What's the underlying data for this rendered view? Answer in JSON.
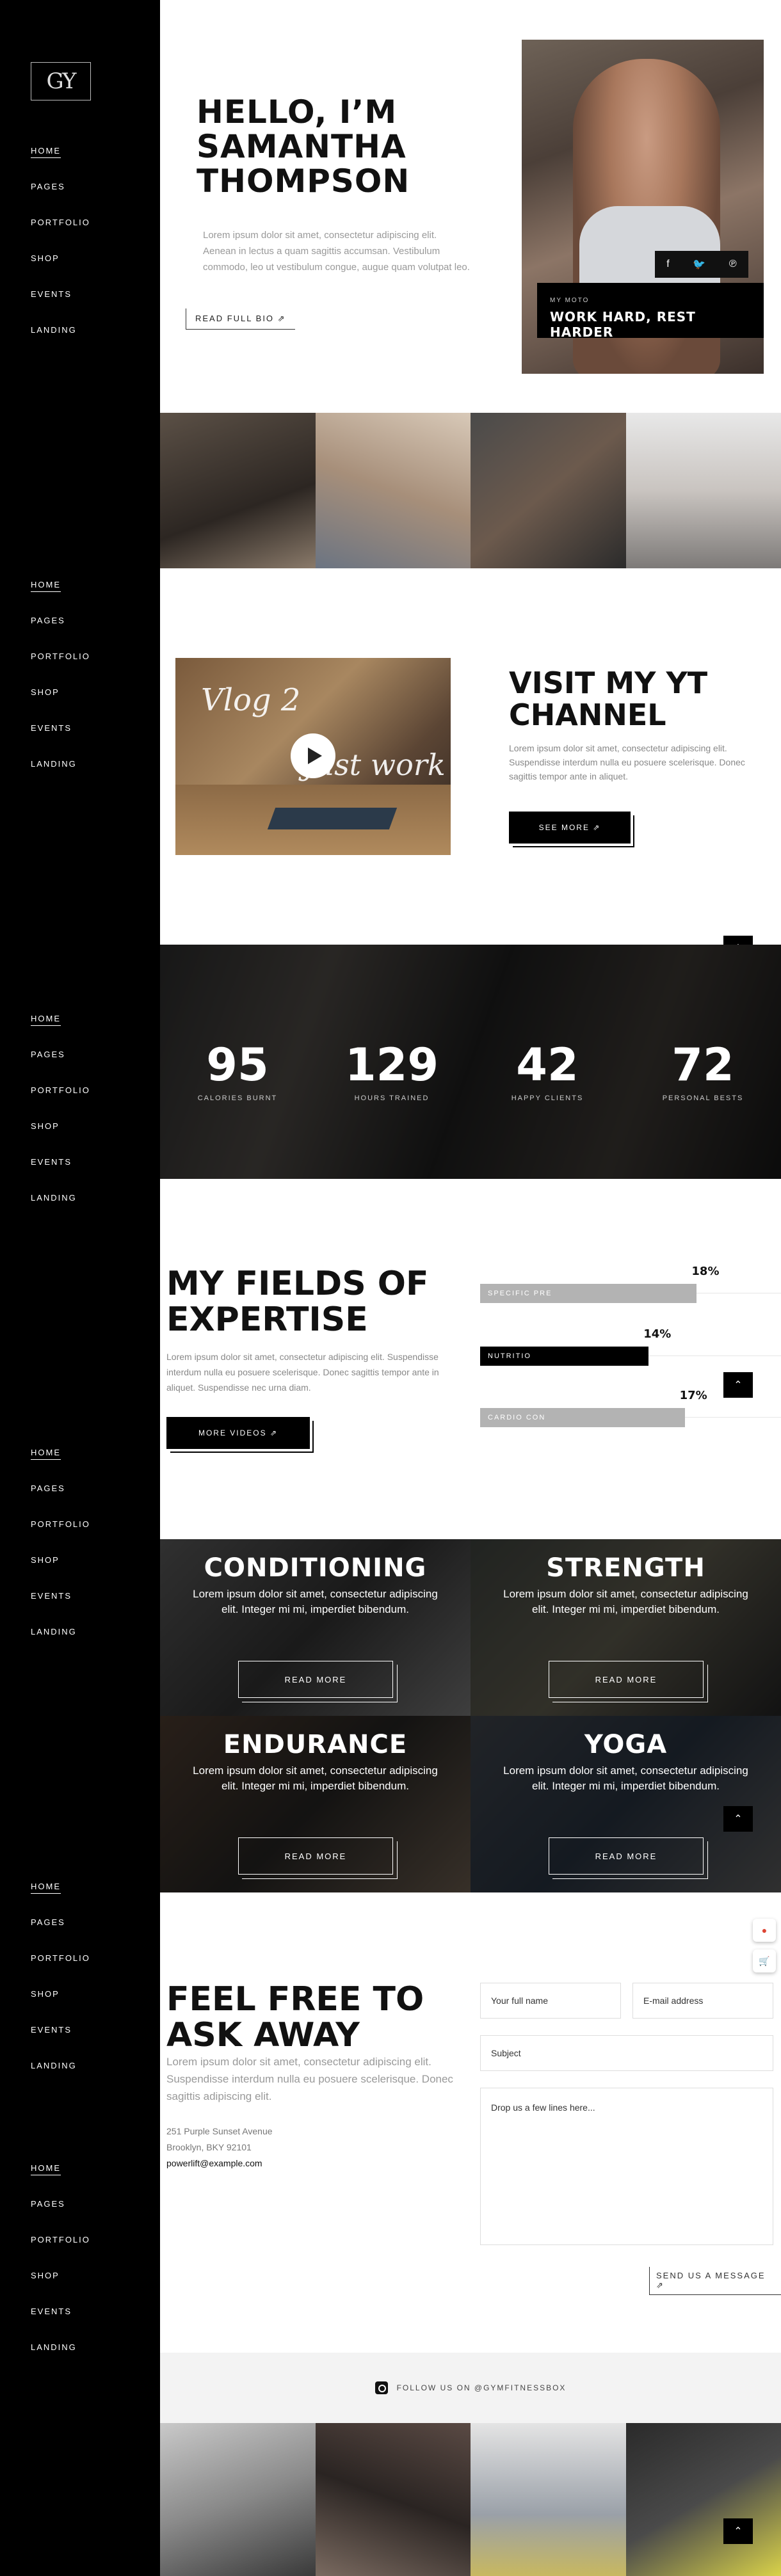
{
  "sidebar": {
    "logo_text": "GY",
    "nav_items": [
      "HOME",
      "PAGES",
      "PORTFOLIO",
      "SHOP",
      "EVENTS",
      "LANDING"
    ]
  },
  "hero": {
    "title_lines": [
      "HELLO, I’M",
      "SAMANTHA",
      "THOMPSON"
    ],
    "text": "Lorem ipsum dolor sit amet, consectetur adipiscing elit. Aenean in lectus a quam sagittis accumsan. Vestibulum commodo, leo ut vestibulum congue, augue quam volutpat leo.",
    "read_bio": "READ FULL BIO ⇗",
    "moto_label": "MY MOTO",
    "moto_text": "WORK HARD, REST HARDER",
    "social_icons": [
      "f",
      "🐦",
      "℗"
    ]
  },
  "yt": {
    "title_lines": [
      "VISIT MY YT",
      "CHANNEL"
    ],
    "text": "Lorem ipsum dolor sit amet, consectetur adipiscing elit. Suspendisse interdum nulla eu posuere scelerisque. Donec sagittis tempor ante in aliquet.",
    "button": "SEE MORE ⇗",
    "thumb_text_1": "Vlog 2",
    "thumb_text_2": "Just work"
  },
  "stats": [
    {
      "num": "95",
      "label": "CALORIES BURNT"
    },
    {
      "num": "129",
      "label": "HOURS TRAINED"
    },
    {
      "num": "42",
      "label": "HAPPY CLIENTS"
    },
    {
      "num": "72",
      "label": "PERSONAL BESTS"
    }
  ],
  "expertise": {
    "title_lines": [
      "MY FIELDS OF",
      "EXPERTISE"
    ],
    "text": "Lorem ipsum dolor sit amet, consectetur adipiscing elit. Suspendisse interdum nulla eu posuere scelerisque. Donec sagittis tempor ante in aliquet. Suspendisse nec urna diam.",
    "button": "MORE VIDEOS ⇗",
    "bars": [
      {
        "label": "SPECIFIC PRE",
        "pct": "18%",
        "value": 18,
        "color": "#b3b3b3"
      },
      {
        "label": "NUTRITIO",
        "pct": "14%",
        "value": 14,
        "color": "#000000"
      },
      {
        "label": "CARDIO CON",
        "pct": "17%",
        "value": 17,
        "color": "#b3b3b3"
      }
    ]
  },
  "cards": [
    {
      "title": "CONDITIONING",
      "text": "Lorem ipsum dolor sit amet, consectetur adipiscing elit. Integer mi mi, imperdiet bibendum.",
      "button": "READ MORE"
    },
    {
      "title": "STRENGTH",
      "text": "Lorem ipsum dolor sit amet, consectetur adipiscing elit. Integer mi mi, imperdiet bibendum.",
      "button": "READ MORE"
    },
    {
      "title": "ENDURANCE",
      "text": "Lorem ipsum dolor sit amet, consectetur adipiscing elit. Integer mi mi, imperdiet bibendum.",
      "button": "READ MORE"
    },
    {
      "title": "YOGA",
      "text": "Lorem ipsum dolor sit amet, consectetur adipiscing elit. Integer mi mi, imperdiet bibendum.",
      "button": "READ MORE"
    }
  ],
  "contact": {
    "title_lines": [
      "FEEL FREE TO",
      "ASK AWAY"
    ],
    "text": "Lorem ipsum dolor sit amet, consectetur adipiscing elit. Suspendisse interdum nulla eu posuere scelerisque. Donec sagittis adipiscing elit.",
    "address_1": "251 Purple Sunset Avenue",
    "address_2": "Brooklyn, BKY 92101",
    "email": "powerlift@example.com",
    "name_placeholder": "Your full name",
    "email_placeholder": "E-mail address",
    "subject_placeholder": "Subject",
    "message_placeholder": "Drop us a few lines here...",
    "send": "SEND US A MESSAGE ⇗"
  },
  "follow": {
    "text": "FOLLOW US ON @GYMFITNESSBOX"
  },
  "scroll_top_icon": "⌃"
}
